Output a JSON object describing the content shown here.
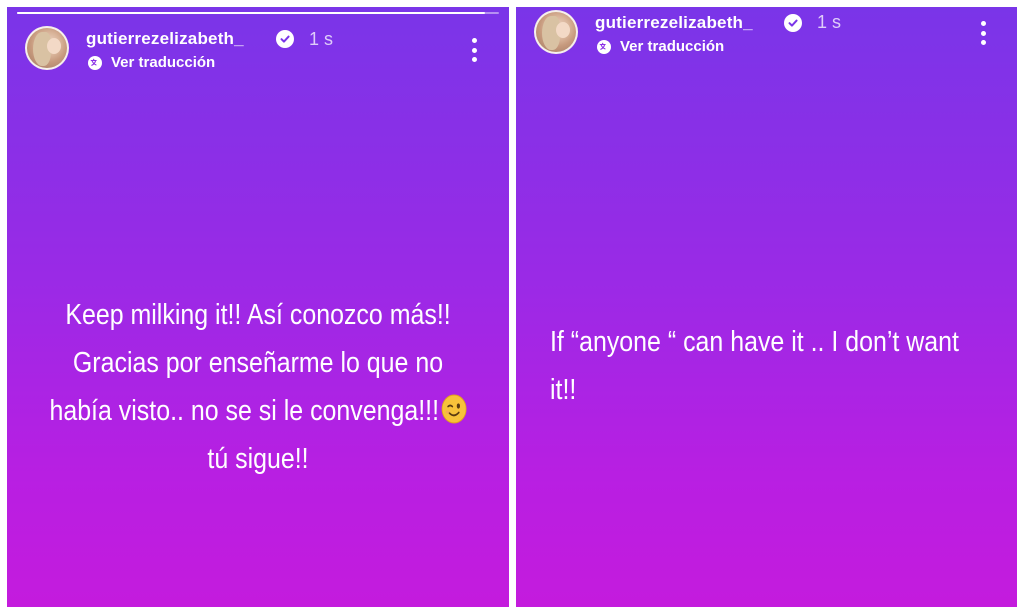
{
  "stories": [
    {
      "username": "gutierrezelizabeth_",
      "timestamp": "1 s",
      "translation_label": "Ver traducción",
      "progress": 0.97,
      "text_lines": [
        "Keep milking it!! Así conozco más!!",
        "Gracias por enseñarme lo que no",
        "había visto.. no se si le convenga!!!",
        "tú sigue!!"
      ],
      "emoji": "winking-face"
    },
    {
      "username": "gutierrezelizabeth_",
      "timestamp": "1 s",
      "translation_label": "Ver traducción",
      "text_lines": [
        "If “anyone “ can have it .. I don’t want",
        "it!!"
      ]
    }
  ],
  "colors": {
    "gradient_top": "#7a35e8",
    "gradient_bottom": "#c41bdd",
    "text": "#ffffff"
  }
}
